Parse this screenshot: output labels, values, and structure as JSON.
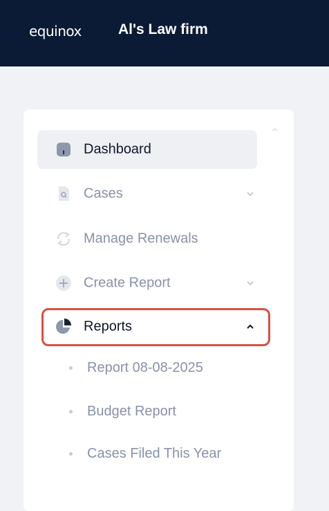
{
  "header": {
    "logo_text": "equinox",
    "firm_name": "Al's Law firm"
  },
  "sidebar": {
    "items": [
      {
        "label": "Dashboard",
        "icon": "dashboard-icon"
      },
      {
        "label": "Cases",
        "icon": "file-search-icon",
        "expandable": true
      },
      {
        "label": "Manage Renewals",
        "icon": "refresh-icon"
      },
      {
        "label": "Create Report",
        "icon": "plus-circle-icon",
        "expandable": true
      },
      {
        "label": "Reports",
        "icon": "pie-chart-icon",
        "expanded": true
      }
    ],
    "reports_submenu": [
      {
        "label": "Report 08-08-2025"
      },
      {
        "label": "Budget Report"
      },
      {
        "label": "Cases Filed This Year"
      }
    ]
  },
  "colors": {
    "header_bg": "#0b1b35",
    "highlight_border": "#d8503f",
    "muted_text": "#8791a8",
    "active_bg": "#eef0f4"
  }
}
